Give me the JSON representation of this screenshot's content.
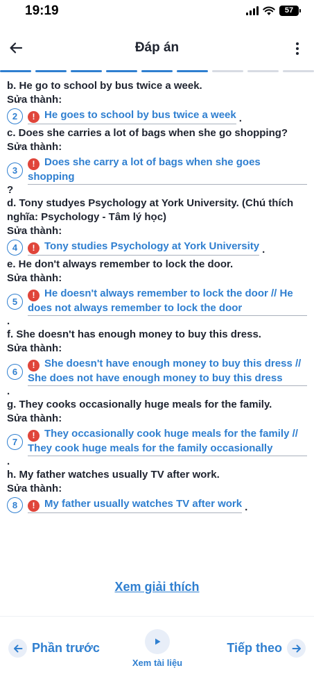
{
  "status_bar": {
    "time": "19:19",
    "battery": "57"
  },
  "header": {
    "title": "Đáp án"
  },
  "progress": {
    "total_segments": 9,
    "completed_segments": 6
  },
  "fix_label": "Sửa thành:",
  "questions": [
    {
      "number": "2",
      "question": "b. He go to school by bus twice a week.",
      "answer": "He goes to school by bus twice a week",
      "trailing": ".",
      "after": ""
    },
    {
      "number": "3",
      "question": "c. Does she carries a lot of bags when she go shopping?",
      "answer": "Does she carry a lot of bags when she goes shopping",
      "trailing": "",
      "after": "?"
    },
    {
      "number": "4",
      "question": "d. Tony studyes Psychology at York University. (Chú thích nghĩa: Psychology - Tâm lý học)",
      "answer": "Tony studies Psychology at York University",
      "trailing": ".",
      "after": ""
    },
    {
      "number": "5",
      "question": "e. He don't always remember to lock the door.",
      "answer": "He doesn't always remember to lock the door // He does not always remember to lock the door",
      "trailing": "",
      "after": "."
    },
    {
      "number": "6",
      "question": "f. She doesn't has enough money to buy this dress.",
      "answer": "She doesn't have enough money to buy this dress // She does not have enough money to buy this dress",
      "trailing": "",
      "after": "."
    },
    {
      "number": "7",
      "question": "g. They cooks occasionally huge meals for the family.",
      "answer": "They occasionally cook huge meals for the family // They cook huge meals for the family occasionally",
      "trailing": "",
      "after": "."
    },
    {
      "number": "8",
      "question": "h. My father watches usually TV after work.",
      "answer": "My father usually watches TV after work",
      "trailing": ".",
      "after": ""
    }
  ],
  "explain_link": "Xem giải thích",
  "footer": {
    "prev_label": "Phần trước",
    "doc_label": "Xem tài liệu",
    "next_label": "Tiếp theo"
  },
  "colors": {
    "accent": "#2f7fd0",
    "warning": "#e0453a",
    "text": "#1f2430"
  },
  "icons": [
    "back-arrow-icon",
    "more-vertical-icon",
    "warning-icon",
    "arrow-left-icon",
    "play-icon",
    "arrow-right-icon"
  ]
}
